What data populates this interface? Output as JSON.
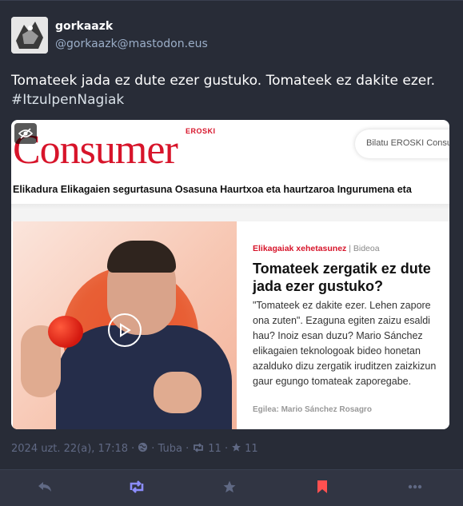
{
  "post": {
    "display_name": "gorkaazk",
    "handle": "@gorkaazk@mastodon.eus",
    "text": "Tomateek jada ez dute ezer gustuko. Tomateek ez dakite ezer.",
    "hashtag": "#ItzulpenNagiak",
    "timestamp": "2024 uzt. 22(a), 17:18",
    "app": "Tuba",
    "boosts": "11",
    "favourites": "11"
  },
  "card": {
    "brand_small": "EROSKI",
    "brand_logo": "Consumer",
    "search_placeholder": "Bilatu EROSKI Consumer",
    "nav": "Elikadura Elikagaien segurtasuna Osasuna Haurtxoa eta haurtzaroa Ingurumena eta",
    "category": "Elikagaiak xehetasunez",
    "category_sep": " | ",
    "category_type": "Bideoa",
    "headline": "Tomateek zergatik ez dute jada ezer gustuko?",
    "lead": "\"Tomateek ez dakite ezer. Lehen zapore ona zuten\". Ezaguna egiten zaizu esaldi hau? Inoiz esan duzu? Mario Sánchez elikagaien teknologoak bideo honetan azalduko dizu zergatik iruditzen zaizkizun gaur egungo tomateak zaporegabe.",
    "author": "Egilea: Mario Sánchez Rosagro"
  },
  "icons": {
    "reply": "reply-icon",
    "boost": "boost-icon",
    "favourite": "star-icon",
    "bookmark": "bookmark-icon",
    "more": "ellipsis-icon",
    "visibility": "globe-icon",
    "hide_media": "eye-slash-icon",
    "play": "play-icon"
  },
  "colors": {
    "background": "#282c37",
    "action_bar": "#313543",
    "muted": "#606984",
    "boost_active": "#8c8dff",
    "bookmark_active": "#ff5050",
    "brand_red": "#d7142a"
  }
}
